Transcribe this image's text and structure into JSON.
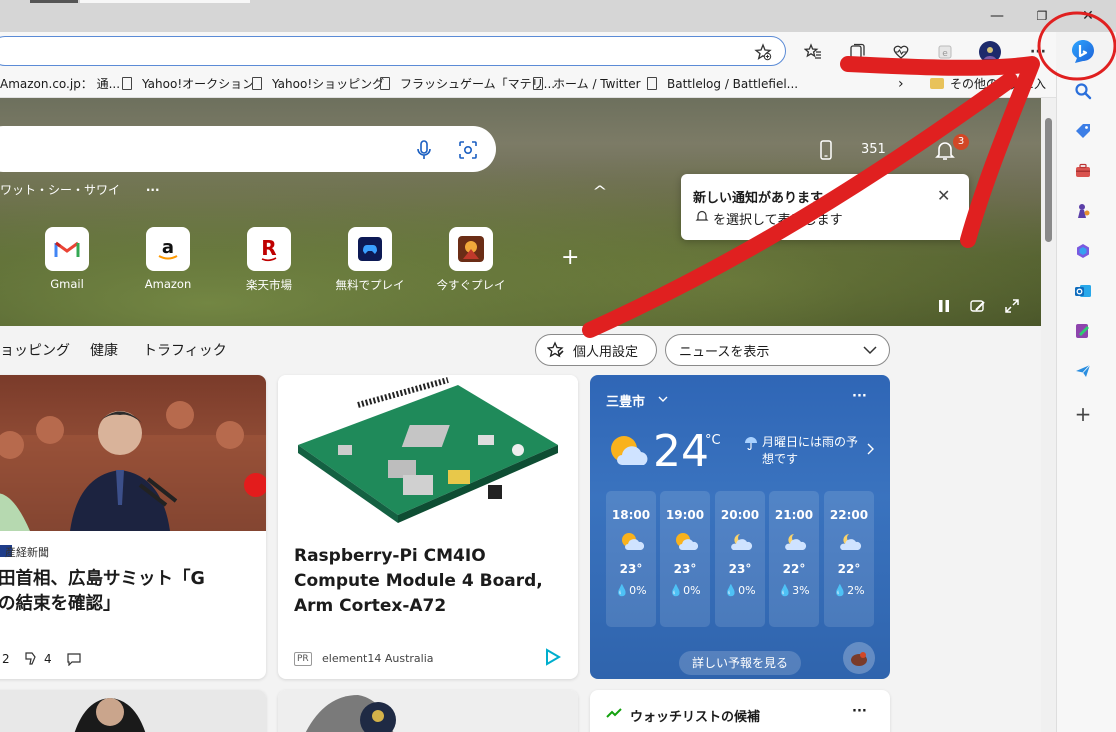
{
  "window": {
    "minimize": "—",
    "restore": "❐",
    "close": "✕"
  },
  "toolbar": {
    "more_label": "···"
  },
  "favorites": [
    {
      "label": "Amazon.co.jp： 通..."
    },
    {
      "label": "Yahoo!オークション"
    },
    {
      "label": "Yahoo!ショッピング"
    },
    {
      "label": "フラッシュゲーム「マテリ..."
    },
    {
      "label": "ホーム / Twitter"
    },
    {
      "label": "Battlelog / Battlefiel..."
    }
  ],
  "favorites_overflow": "›",
  "favorites_folder": "その他のお気に入り",
  "hero": {
    "search_placeholder": "",
    "links": "ワット・シー・サワイ",
    "links_more": "···",
    "points": "351",
    "notifications_count": "3",
    "collapse_chevron": "^",
    "tiles": [
      {
        "label": "Gmail",
        "icon": "gmail-icon"
      },
      {
        "label": "Amazon",
        "icon": "amazon-icon"
      },
      {
        "label": "楽天市場",
        "icon": "rakuten-icon"
      },
      {
        "label": "無料でプレイ",
        "icon": "game-icon"
      },
      {
        "label": "今すぐプレイ",
        "icon": "game2-icon"
      }
    ],
    "add_tile": "+"
  },
  "notification": {
    "title": "新しい通知があります",
    "body": "を選択して表示します",
    "close": "✕"
  },
  "nav": {
    "links": [
      "ョッピング",
      "健康",
      "トラフィック"
    ],
    "personalize": "個人用設定",
    "news_dropdown": "ニュースを表示"
  },
  "cards": {
    "news1": {
      "source": "産経新聞",
      "title": "田首相、広島サミット「G\nの結束を確認」",
      "likes": "2",
      "dislikes": "4"
    },
    "ad": {
      "title": "Raspberry-Pi CM4IO Compute Module 4 Board, Arm Cortex-A72",
      "pr": "PR",
      "advertiser": "element14 Australia"
    },
    "weather": {
      "city": "三豊市",
      "temp": "24",
      "unit": "°C",
      "forecast": "月曜日には雨の予想です",
      "more": "···",
      "hours": [
        {
          "time": "18:00",
          "temp": "23°",
          "rain": "0%"
        },
        {
          "time": "19:00",
          "temp": "23°",
          "rain": "0%"
        },
        {
          "time": "20:00",
          "temp": "23°",
          "rain": "0%"
        },
        {
          "time": "21:00",
          "temp": "22°",
          "rain": "3%"
        },
        {
          "time": "22:00",
          "temp": "22°",
          "rain": "2%"
        }
      ],
      "detail_button": "詳しい予報を見る"
    },
    "watchlist": {
      "title": "ウォッチリストの候補",
      "more": "···"
    }
  },
  "colors": {
    "annotation": "#e02020",
    "accent": "#0f6cbd"
  }
}
